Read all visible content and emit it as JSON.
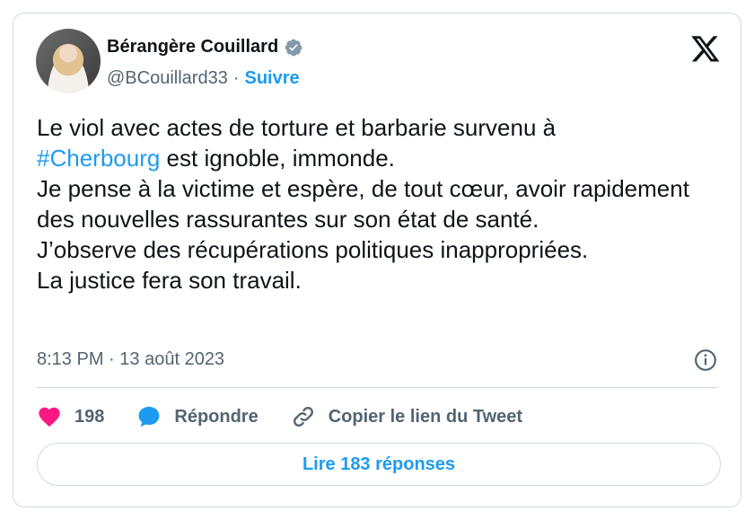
{
  "author": {
    "name": "Bérangère Couillard",
    "handle": "@BCouillard33",
    "separator": "·",
    "follow_label": "Suivre"
  },
  "tweet": {
    "line1": "Le viol avec actes de torture et barbarie survenu à",
    "hashtag": "#Cherbourg",
    "line2_rest": " est ignoble, immonde.",
    "line3": "Je pense à la victime et espère, de tout cœur, avoir rapidement des nouvelles rassurantes sur son état de santé.",
    "line4": "J’observe des récupérations politiques inappropriées.",
    "line5": "La justice fera son travail."
  },
  "meta": {
    "time": "8:13 PM",
    "separator": "·",
    "date": "13 août 2023"
  },
  "actions": {
    "likes": "198",
    "reply_label": "Répondre",
    "copy_label": "Copier le lien du Tweet"
  },
  "replies_button": "Lire 183 réponses",
  "icons": [
    "verified-badge-icon",
    "x-logo-icon",
    "info-icon",
    "heart-icon",
    "reply-bubble-icon",
    "link-icon"
  ],
  "colors": {
    "accent": "#1d9bf0",
    "like": "#f91880",
    "muted": "#536471",
    "border": "#cfd9de"
  }
}
